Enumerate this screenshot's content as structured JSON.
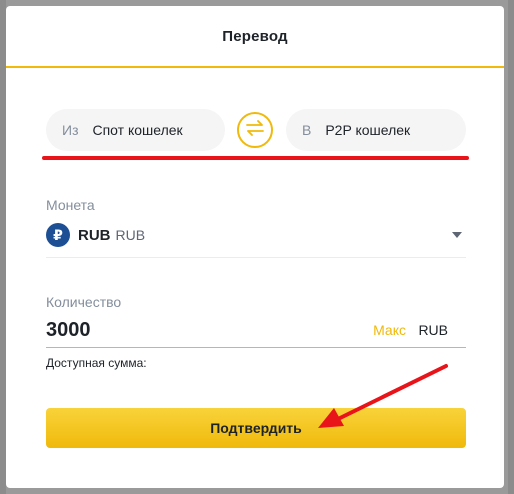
{
  "modal": {
    "title": "Перевод"
  },
  "transfer": {
    "from_prefix": "Из",
    "from_wallet": "Спот кошелек",
    "to_prefix": "В",
    "to_wallet": "P2P кошелек"
  },
  "coin": {
    "label": "Монета",
    "icon_glyph": "₽",
    "symbol": "RUB",
    "name": "RUB"
  },
  "quantity": {
    "label": "Количество",
    "value": "3000",
    "max_label": "Макс",
    "unit": "RUB",
    "available_label": "Доступная сумма:"
  },
  "confirm_label": "Подтвердить",
  "colors": {
    "accent": "#f0b90b",
    "annotation": "#e8141a",
    "coin_icon": "#1d4f95"
  },
  "icons": [
    "swap-icon",
    "ruble-coin-icon",
    "chevron-down-icon"
  ]
}
